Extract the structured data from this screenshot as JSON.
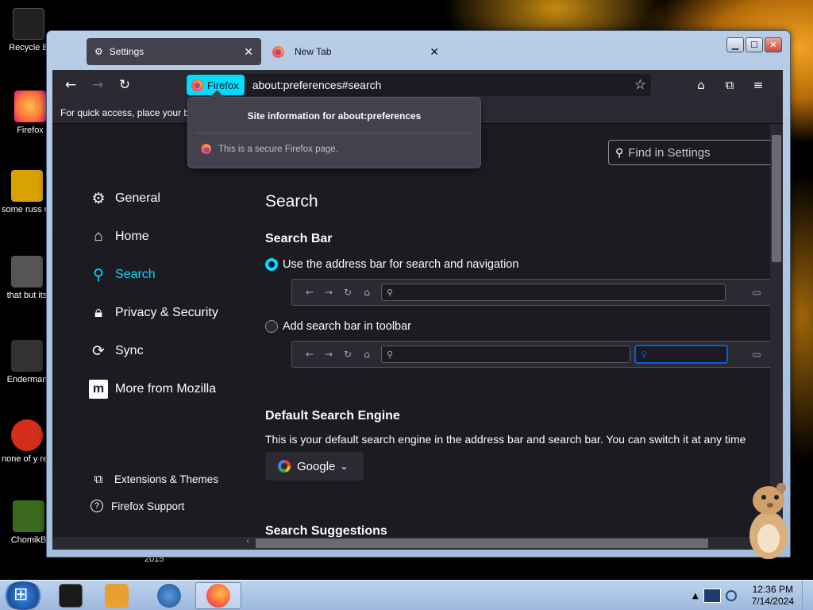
{
  "desktop": {
    "icons": [
      {
        "label": "Recycle B",
        "color": "#222"
      },
      {
        "label": "Firefox",
        "color": "#ff9400"
      },
      {
        "label": "some russ ran a ra",
        "color": "#d8a300"
      },
      {
        "label": "that but its",
        "color": "#555"
      },
      {
        "label": "Enderman",
        "color": "#333"
      },
      {
        "label": "none of y retards kn",
        "color": "#d42d1b"
      },
      {
        "label": "ChomikB",
        "color": "#3b6a1e"
      }
    ],
    "year_label": "2015"
  },
  "window": {
    "controls": {
      "minimize": "▁",
      "maximize": "☐",
      "close": "✕"
    },
    "tabs": [
      {
        "label": "Settings",
        "icon": "gear-icon",
        "close": "✕"
      },
      {
        "label": "New Tab",
        "icon": "firefox-icon",
        "close": "✕"
      }
    ]
  },
  "navbar": {
    "back": "←",
    "forward": "→",
    "reload": "↻",
    "identity_label": "Firefox",
    "url": "about:preferences#search",
    "bookmark_star": "☆",
    "pocket": "⌂",
    "extensions": "⧉",
    "menu": "≡"
  },
  "bookmarks_bar": {
    "text": "For quick access, place your bo"
  },
  "popup": {
    "title": "Site information for about:preferences",
    "row": "This is a secure Firefox page."
  },
  "settings": {
    "find_placeholder": "Find in Settings",
    "categories": [
      {
        "label": "General",
        "icon": "gear-icon",
        "glyph": "⚙"
      },
      {
        "label": "Home",
        "icon": "home-icon",
        "glyph": "⌂"
      },
      {
        "label": "Search",
        "icon": "search-icon",
        "glyph": "⚲"
      },
      {
        "label": "Privacy & Security",
        "icon": "lock-icon",
        "glyph": "🔒︎"
      },
      {
        "label": "Sync",
        "icon": "sync-icon",
        "glyph": "⟳"
      },
      {
        "label": "More from Mozilla",
        "icon": "mozilla-icon",
        "glyph": "m"
      }
    ],
    "footer_links": [
      {
        "label": "Extensions & Themes",
        "icon": "puzzle-icon",
        "glyph": "⧉"
      },
      {
        "label": "Firefox Support",
        "icon": "help-icon",
        "glyph": "?"
      }
    ],
    "page_title": "Search",
    "search_bar_heading": "Search Bar",
    "option_address_bar": "Use the address bar for search and navigation",
    "option_toolbar": "Add search bar in toolbar",
    "selected_option": "address_bar",
    "default_engine_heading": "Default Search Engine",
    "default_engine_desc": "This is your default search engine in the address bar and search bar. You can switch it at any time",
    "default_engine_value": "Google",
    "suggestions_heading": "Search Suggestions"
  },
  "taskbar": {
    "time": "12:36 PM",
    "date": "7/14/2024",
    "items": [
      {
        "name": "terminal",
        "color": "#1a1a1a"
      },
      {
        "name": "media-player",
        "color": "#e8a030"
      },
      {
        "name": "globe",
        "color": "#1f4f8f"
      },
      {
        "name": "firefox",
        "color": "#ff7139"
      }
    ]
  },
  "colors": {
    "accent": "#00ddff",
    "content_bg": "#1c1b22",
    "chrome_bg": "#2b2a33"
  }
}
